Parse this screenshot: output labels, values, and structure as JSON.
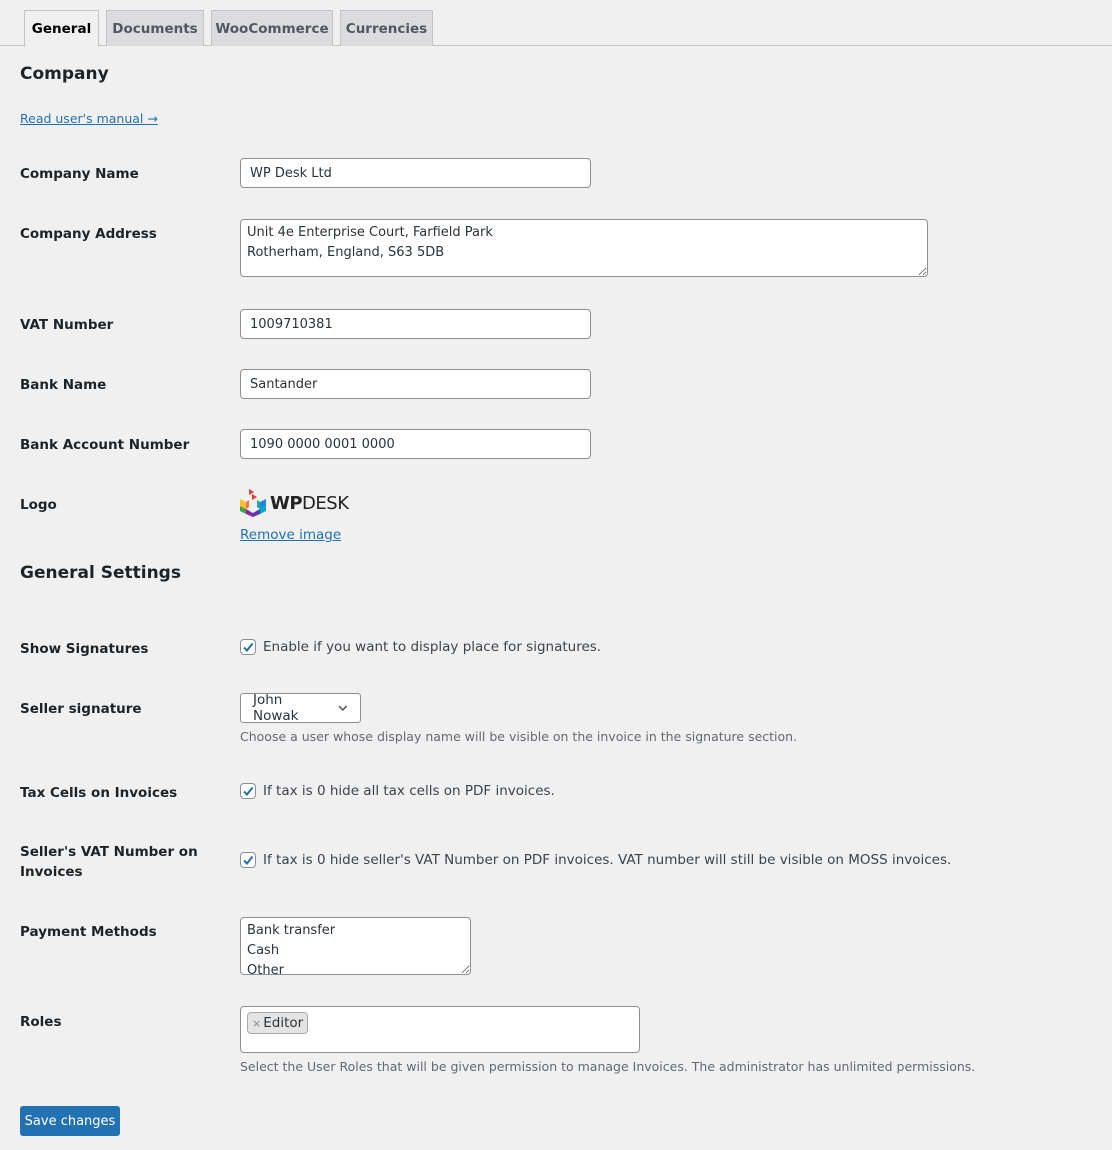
{
  "tabs": [
    {
      "label": "General",
      "active": true
    },
    {
      "label": "Documents",
      "active": false
    },
    {
      "label": "WooCommerce",
      "active": false
    },
    {
      "label": "Currencies",
      "active": false
    }
  ],
  "company": {
    "heading": "Company",
    "manual_link": "Read user's manual →",
    "fields": {
      "company_name": {
        "label": "Company Name",
        "value": "WP Desk Ltd"
      },
      "company_address": {
        "label": "Company Address",
        "value": "Unit 4e Enterprise Court, Farfield Park\nRotherham, England, S63 5DB"
      },
      "vat_number": {
        "label": "VAT Number",
        "value": "1009710381"
      },
      "bank_name": {
        "label": "Bank Name",
        "value": "Santander"
      },
      "bank_account": {
        "label": "Bank Account Number",
        "value": "1090 0000 0001 0000"
      },
      "logo": {
        "label": "Logo",
        "logo_text_bold": "WP",
        "logo_text_light": "DESK",
        "remove_link": "Remove image"
      }
    }
  },
  "general_settings": {
    "heading": "General Settings",
    "show_signatures": {
      "label": "Show Signatures",
      "checked": true,
      "text": "Enable if you want to display place for signatures."
    },
    "seller_signature": {
      "label": "Seller signature",
      "selected": "John Nowak",
      "description": "Choose a user whose display name will be visible on the invoice in the signature section."
    },
    "tax_cells": {
      "label": "Tax Cells on Invoices",
      "checked": true,
      "text": "If tax is 0 hide all tax cells on PDF invoices."
    },
    "seller_vat": {
      "label": "Seller's VAT Number on Invoices",
      "checked": true,
      "text": "If tax is 0 hide seller's VAT Number on PDF invoices. VAT number will still be visible on MOSS invoices."
    },
    "payment_methods": {
      "label": "Payment Methods",
      "value": "Bank transfer\nCash\nOther"
    },
    "roles": {
      "label": "Roles",
      "tags": [
        "Editor"
      ],
      "remove_glyph": "×",
      "description": "Select the User Roles that will be given permission to manage Invoices. The administrator has unlimited permissions."
    }
  },
  "save_button": "Save changes",
  "colors": {
    "accent": "#2271b1",
    "background": "#f0f0f1",
    "text": "#1d2327"
  }
}
